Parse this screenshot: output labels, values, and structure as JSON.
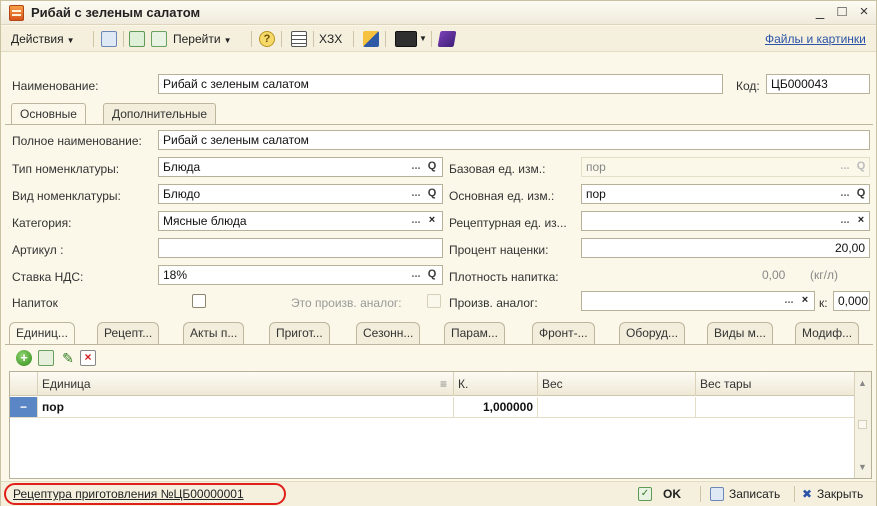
{
  "window": {
    "title": "Рибай с зеленым салатом",
    "min_label": "_",
    "max_label": "□",
    "close_label": "×"
  },
  "toolbar": {
    "actions_label": "Действия",
    "goto_label": "Перейти",
    "xzx_label": "XЗX",
    "files_link": "Файлы и картинки"
  },
  "header": {
    "name_label": "Наименование:",
    "name_value": "Рибай с зеленым салатом",
    "code_label": "Код:",
    "code_value": "ЦБ000043"
  },
  "tabs_top": {
    "main": "Основные",
    "extra": "Дополнительные"
  },
  "form": {
    "fullname_label": "Полное наименование:",
    "fullname_value": "Рибай с зеленым салатом",
    "nomtype_label": "Тип номенклатуры:",
    "nomtype_value": "Блюда",
    "nomkind_label": "Вид номенклатуры:",
    "nomkind_value": "Блюдо",
    "category_label": "Категория:",
    "category_value": "Мясные блюда",
    "article_label": "Артикул :",
    "article_value": "",
    "vat_label": "Ставка НДС:",
    "vat_value": "18%",
    "drink_label": "Напиток",
    "analog_prod_label": "Это произв. аналог:",
    "base_unit_label": "Базовая ед. изм.:",
    "base_unit_value": "пор",
    "main_unit_label": "Основная ед. изм.:",
    "main_unit_value": "пор",
    "recipe_unit_label": "Рецептурная ед. из...",
    "recipe_unit_value": "",
    "markup_label": "Процент наценки:",
    "markup_value": "20,00",
    "density_label": "Плотность напитка:",
    "density_value": "0,00",
    "density_unit": "(кг/л)",
    "prod_analog_label": "Произв. аналог:",
    "prod_analog_value": "",
    "k_label": "к:",
    "k_value": "0,000"
  },
  "tabs_bottom": [
    "Единиц...",
    "Рецепт...",
    "Акты п...",
    "Пригот...",
    "Сезонн...",
    "Парам...",
    "Фронт-...",
    "Оборуд...",
    "Виды м...",
    "Модиф..."
  ],
  "grid": {
    "headers": {
      "unit": "Единица",
      "k": "К.",
      "weight": "Вес",
      "tare": "Вес тары"
    },
    "rows": [
      {
        "marker": "−",
        "unit": "пор",
        "k": "1,000000",
        "weight": "",
        "tare": ""
      }
    ]
  },
  "footer": {
    "recipe_link": "Рецептура приготовления №ЦБ00000001",
    "ok_label": "OK",
    "save_label": "Записать",
    "close_label": "Закрыть"
  },
  "colors": {
    "background": "#fbf7e9",
    "link": "#2b53a7",
    "highlight_oval": "#e0201b"
  }
}
